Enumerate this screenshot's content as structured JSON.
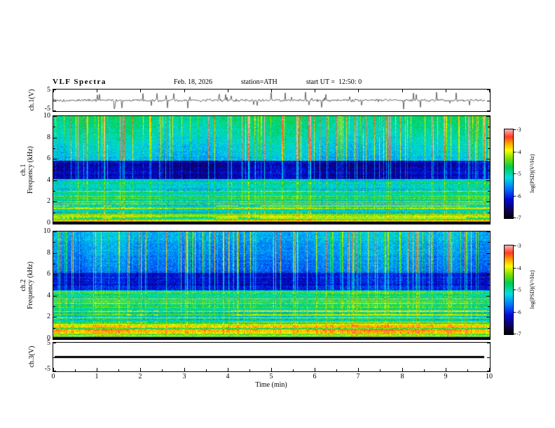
{
  "header": {
    "title": "VLF Spectra",
    "date": "Feb. 18, 2026",
    "station": "station=ATH",
    "start_ut": "start UT =  12:50: 0"
  },
  "xaxis": {
    "label": "Time (min)",
    "range": [
      0,
      10
    ],
    "ticks": [
      "0",
      "1",
      "2",
      "3",
      "4",
      "5",
      "6",
      "7",
      "8",
      "9",
      "10"
    ]
  },
  "panels": {
    "ch1_wave": {
      "ylabel": "ch.1(V)",
      "yticks": [
        "5",
        "-5"
      ],
      "ylim": [
        -5,
        5
      ]
    },
    "ch1_spec": {
      "ylabel": "ch.1\nFrequency (kHz)",
      "yticks": [
        "10",
        "8",
        "6",
        "4",
        "2",
        "0"
      ],
      "ylim": [
        0,
        10
      ]
    },
    "ch2_spec": {
      "ylabel": "ch.2\nFrequency (kHz)",
      "yticks": [
        "10",
        "8",
        "6",
        "4",
        "2",
        "0"
      ],
      "ylim": [
        0,
        10
      ]
    },
    "ch3_wave": {
      "ylabel": "ch.3(V)",
      "yticks": [
        "5",
        "-5"
      ],
      "ylim": [
        -5,
        5
      ]
    }
  },
  "colorbar": {
    "label": "log(PSD)(V²/Hz)",
    "ticks": [
      "-3",
      "-4",
      "-5",
      "-6",
      "-7"
    ],
    "range": [
      -7,
      -3
    ],
    "colors": {
      "low": "#000000",
      "mid": "#00dcdc",
      "high": "#ffafaf"
    }
  },
  "chart_data": [
    {
      "type": "line",
      "name": "ch.1 voltage waveform",
      "ylabel": "ch.1(V)",
      "xlim": [
        0,
        10
      ],
      "ylim": [
        -5,
        5
      ],
      "description": "Broadband noise around 0 V with frequent impulsive sferic spikes reaching several volts in both polarities across the full 10 minutes",
      "render": {
        "seed": 20260218,
        "noise": 0.7,
        "spike_prob": 0.05,
        "spike": 2.8
      }
    },
    {
      "type": "heatmap",
      "name": "ch.1 spectrogram",
      "xlabel": "Time (min)",
      "ylabel": "Frequency (kHz)",
      "zlabel": "log(PSD)(V²/Hz)",
      "xlim": [
        0,
        10
      ],
      "ylim": [
        0,
        10
      ],
      "zlim": [
        -7,
        -3
      ],
      "description": "Dense vertical sferic streaks over 6-10 kHz on a green/cyan background, quiet dark-blue band 4.2-5.9 kHz, horizontally striped bands below 3.2 kHz with intermittent strong red/orange lines, near-zero (black) strip at 0-0.2 kHz",
      "render": {
        "seed": 11,
        "bands": [
          {
            "f": [
              0,
              0.22
            ],
            "level": -7
          },
          {
            "f": [
              0.22,
              1.1
            ],
            "level": -4.5,
            "stripe": 1,
            "streak": 0.2,
            "hot_rows": true
          },
          {
            "f": [
              1.1,
              3.2
            ],
            "level": -4.9,
            "stripe": 1,
            "streak": 0.25,
            "hot_rows": true
          },
          {
            "f": [
              3.2,
              4.2
            ],
            "level": -5.1,
            "stripe": 0.5,
            "streak": 0.35
          },
          {
            "f": [
              4.2,
              5.9
            ],
            "level": -6.3,
            "stripe": 0.15,
            "streak": 0.5
          },
          {
            "f": [
              5.9,
              10
            ],
            "level": -5.1,
            "stripe": 0.1,
            "streak": 1,
            "grad": 0.3
          }
        ]
      }
    },
    {
      "type": "heatmap",
      "name": "ch.2 spectrogram",
      "xlabel": "Time (min)",
      "ylabel": "Frequency (kHz)",
      "zlabel": "log(PSD)(V²/Hz)",
      "xlim": [
        0,
        10
      ],
      "ylim": [
        0,
        10
      ],
      "zlim": [
        -7,
        -3
      ],
      "description": "Vertical sferic streaks over 6-10 kHz on a bluer background, dark band 4.6-6.2 kHz, strong horizontally striped green/yellow/red bands below 4.6 kHz, near-zero (black) strip at 0-0.2 kHz",
      "render": {
        "seed": 47,
        "bands": [
          {
            "f": [
              0,
              0.22
            ],
            "level": -7
          },
          {
            "f": [
              0.22,
              1.3
            ],
            "level": -4.3,
            "stripe": 1,
            "streak": 0.2,
            "hot_rows": true
          },
          {
            "f": [
              1.3,
              2.7
            ],
            "level": -4.8,
            "stripe": 1,
            "streak": 0.25,
            "hot_rows": true
          },
          {
            "f": [
              2.7,
              4.6
            ],
            "level": -4.7,
            "stripe": 0.8,
            "streak": 0.3
          },
          {
            "f": [
              4.6,
              6.2
            ],
            "level": -6.1,
            "stripe": 0.2,
            "streak": 0.5
          },
          {
            "f": [
              6.2,
              10
            ],
            "level": -5.5,
            "stripe": 0.1,
            "streak": 1,
            "grad": 0.2
          }
        ]
      }
    },
    {
      "type": "line",
      "name": "ch.3 voltage waveform",
      "ylabel": "ch.3(V)",
      "xlim": [
        0,
        10
      ],
      "ylim": [
        -5,
        5
      ],
      "description": "Flat thick line at 0 V for the entire record (channel inactive)",
      "render": {
        "flat": 0
      }
    }
  ]
}
